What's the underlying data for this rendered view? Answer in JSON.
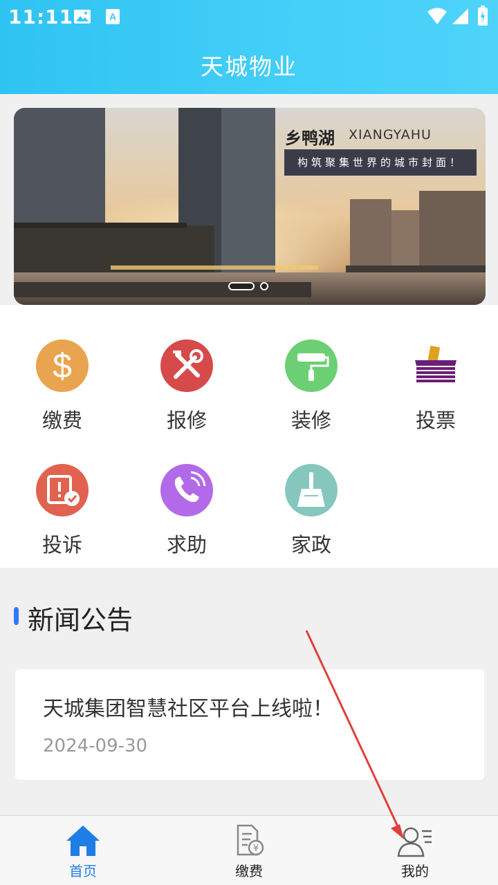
{
  "status_bar": {
    "time": "11:11"
  },
  "header": {
    "title": "天城物业"
  },
  "banner": {
    "brand": "乡鸭湖",
    "brand_en": "XIANGYAHU",
    "slogan": "构筑聚集世界的城市封面！",
    "slide_count": 2,
    "active_slide": 1
  },
  "services": [
    {
      "label": "缴费",
      "icon": "dollar-icon",
      "color": "#e9a450"
    },
    {
      "label": "报修",
      "icon": "tools-icon",
      "color": "#d64a4a"
    },
    {
      "label": "装修",
      "icon": "paint-roller-icon",
      "color": "#6dcf73"
    },
    {
      "label": "投票",
      "icon": "ballot-box-icon",
      "color": "#6b1e76"
    },
    {
      "label": "投诉",
      "icon": "complaint-icon",
      "color": "#e0624f"
    },
    {
      "label": "求助",
      "icon": "phone-icon",
      "color": "#b26ae8"
    },
    {
      "label": "家政",
      "icon": "broom-icon",
      "color": "#86c7bd"
    }
  ],
  "news": {
    "section_title": "新闻公告",
    "items": [
      {
        "title": "天城集团智慧社区平台上线啦！",
        "date": "2024-09-30"
      }
    ]
  },
  "tabbar": {
    "tabs": [
      {
        "label": "首页",
        "icon": "home-icon",
        "active": true
      },
      {
        "label": "缴费",
        "icon": "bill-icon",
        "active": false
      },
      {
        "label": "我的",
        "icon": "user-icon",
        "active": false
      }
    ],
    "accent": "#1e7ee6"
  }
}
